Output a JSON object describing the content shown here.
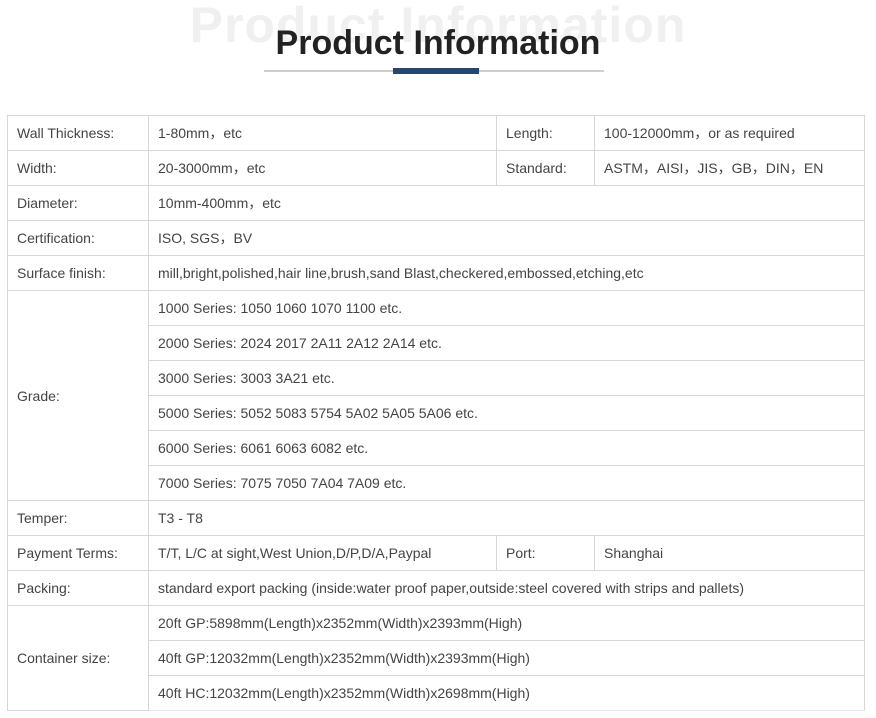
{
  "header": {
    "background_title": "Product Information",
    "title": "Product Information",
    "accent_color": "#26466e"
  },
  "spec": {
    "wall_thickness": {
      "label": "Wall Thickness:",
      "value": "1-80mm，etc"
    },
    "length": {
      "label": "Length:",
      "value": "100-12000mm，or as required"
    },
    "width": {
      "label": "Width:",
      "value": "20-3000mm，etc"
    },
    "standard": {
      "label": "Standard:",
      "value": "ASTM，AISI，JIS，GB，DIN，EN"
    },
    "diameter": {
      "label": "Diameter:",
      "value": "10mm-400mm，etc"
    },
    "certification": {
      "label": "Certification:",
      "value": "ISO, SGS，BV"
    },
    "surface_finish": {
      "label": "Surface finish:",
      "value": "mill,bright,polished,hair line,brush,sand Blast,checkered,embossed,etching,etc"
    },
    "grade": {
      "label": "Grade:",
      "values": [
        "1000 Series: 1050 1060 1070 1100 etc.",
        "2000 Series: 2024 2017 2A11 2A12 2A14 etc.",
        "3000 Series: 3003 3A21 etc.",
        "5000 Series: 5052 5083 5754 5A02 5A05 5A06 etc.",
        "6000 Series: 6061 6063 6082 etc.",
        "7000 Series: 7075 7050 7A04 7A09 etc."
      ]
    },
    "temper": {
      "label": "Temper:",
      "value": "T3 - T8"
    },
    "payment_terms": {
      "label": "Payment Terms:",
      "value": "T/T, L/C at sight,West Union,D/P,D/A,Paypal"
    },
    "port": {
      "label": "Port:",
      "value": "Shanghai"
    },
    "packing": {
      "label": "Packing:",
      "value": "standard export packing (inside:water proof paper,outside:steel covered with strips and pallets)"
    },
    "container_size": {
      "label": "Container size:",
      "values": [
        "20ft GP:5898mm(Length)x2352mm(Width)x2393mm(High)",
        "40ft GP:12032mm(Length)x2352mm(Width)x2393mm(High)",
        "40ft HC:12032mm(Length)x2352mm(Width)x2698mm(High)"
      ]
    }
  }
}
